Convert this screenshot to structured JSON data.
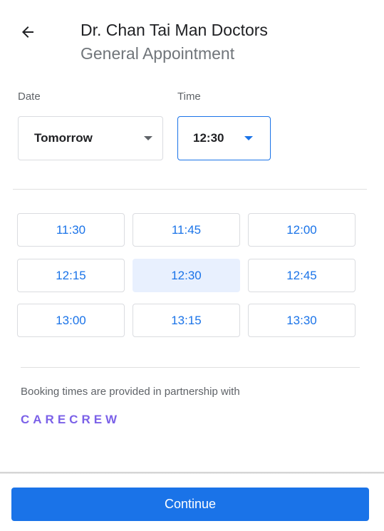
{
  "header": {
    "title": "Dr. Chan Tai Man Doctors",
    "subtitle": "General Appointment",
    "back_icon": "arrow-left-icon"
  },
  "date_field": {
    "label": "Date",
    "value": "Tomorrow",
    "icon": "dropdown-caret-icon"
  },
  "time_field": {
    "label": "Time",
    "value": "12:30",
    "icon": "dropdown-caret-icon"
  },
  "slots": [
    "11:30",
    "11:45",
    "12:00",
    "12:15",
    "12:30",
    "12:45",
    "13:00",
    "13:15",
    "13:30"
  ],
  "selected_slot": "12:30",
  "partner": {
    "text": "Booking times are provided in partnership with",
    "name": "CARECREW"
  },
  "footer": {
    "continue_label": "Continue"
  },
  "colors": {
    "accent": "#1a73e8",
    "selected_bg": "#e8f0fe",
    "partner": "#7b61e8"
  }
}
